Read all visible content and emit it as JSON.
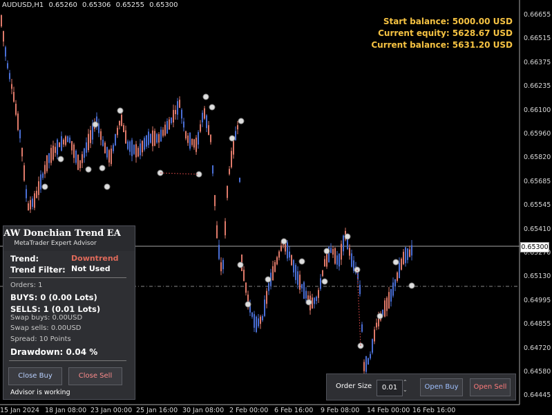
{
  "header": {
    "symbol": "AUDUSD,H1",
    "open": "0.65260",
    "high": "0.65306",
    "low": "0.65255",
    "close": "0.65300"
  },
  "balance": {
    "start": "Start balance: 5000.00 USD",
    "equity": "Current equity: 5628.67 USD",
    "current": "Current balance: 5631.20 USD"
  },
  "price_axis": [
    "0.66655",
    "0.66515",
    "0.66375",
    "0.66235",
    "0.66100",
    "0.65960",
    "0.65820",
    "0.65685",
    "0.65545",
    "0.65410",
    "0.65270",
    "0.65130",
    "0.64995",
    "0.64855",
    "0.64720",
    "0.64580",
    "0.64445"
  ],
  "current_price": "0.65300",
  "time_axis": [
    "15 Jan 2024",
    "18 Jan 08:00",
    "23 Jan 00:00",
    "25 Jan 16:00",
    "30 Jan 08:00",
    "2 Feb 00:00",
    "6 Feb 16:00",
    "9 Feb 08:00",
    "14 Feb 00:00",
    "16 Feb 16:00"
  ],
  "panel": {
    "title": "AW Donchian Trend EA",
    "subtitle": "MetaTrader Expert Advisor",
    "minimize": "–",
    "trend_label": "Trend:",
    "trend_value": "Downtrend",
    "filter_label": "Trend Filter:",
    "filter_value": "Not Used",
    "orders": "Orders: 1",
    "buys": "BUYS: 0 (0.00 Lots)",
    "sells": "SELLS: 1 (0.01 Lots)",
    "swap_buys": "Swap buys: 0.00USD",
    "swap_sells": "Swap sells: 0.00USD",
    "spread": "Spread: 10 Points",
    "drawdown": "Drawdown: 0.04 %",
    "close_buy": "Close Buy",
    "close_sell": "Close Sell",
    "status": "Advisor is working"
  },
  "order": {
    "label": "Order Size",
    "size": "0.01",
    "open_buy": "Open Buy",
    "open_sell": "Open Sell"
  },
  "colors": {
    "bull": "#4a6fd6",
    "bear": "#e07a6a",
    "trend_down": "#e06a5a",
    "balance_text": "#f5c242",
    "open_sell": "#ff7b7b",
    "close_sell": "#ff8c8c",
    "open_buy": "#9fc0ff",
    "close_buy": "#b8d0ff"
  }
}
